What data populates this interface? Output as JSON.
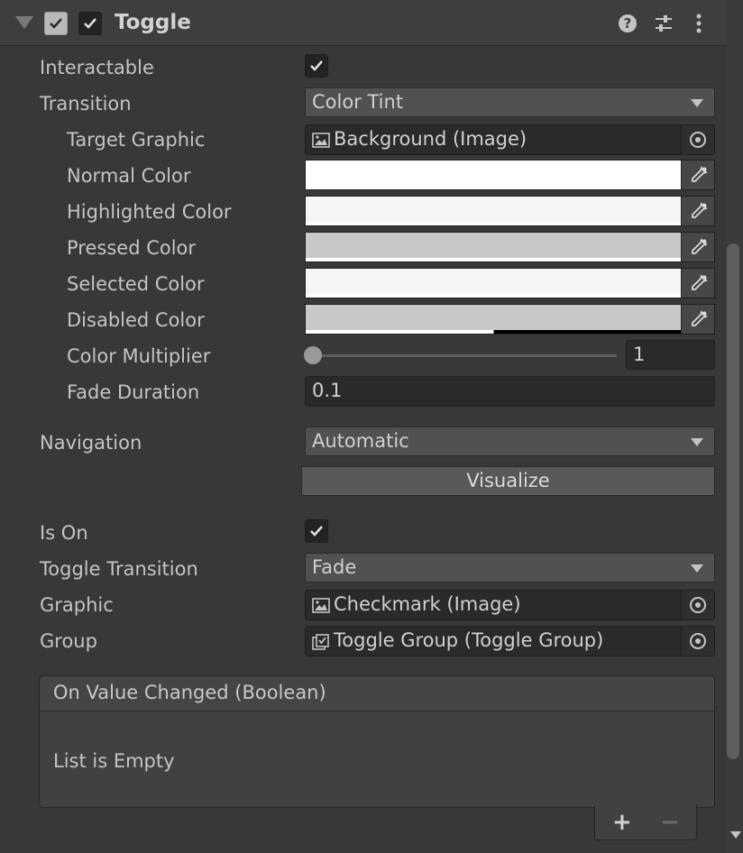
{
  "component": {
    "title": "Toggle"
  },
  "fields": {
    "interactable_label": "Interactable",
    "transition_label": "Transition",
    "transition_value": "Color Tint",
    "target_graphic_label": "Target Graphic",
    "target_graphic_value": "Background (Image)",
    "normal_color_label": "Normal Color",
    "highlighted_color_label": "Highlighted Color",
    "pressed_color_label": "Pressed Color",
    "selected_color_label": "Selected Color",
    "disabled_color_label": "Disabled Color",
    "color_multiplier_label": "Color Multiplier",
    "color_multiplier_value": "1",
    "fade_duration_label": "Fade Duration",
    "fade_duration_value": "0.1",
    "navigation_label": "Navigation",
    "navigation_value": "Automatic",
    "visualize_label": "Visualize",
    "is_on_label": "Is On",
    "toggle_transition_label": "Toggle Transition",
    "toggle_transition_value": "Fade",
    "graphic_label": "Graphic",
    "graphic_value": "Checkmark (Image)",
    "group_label": "Group",
    "group_value": "Toggle Group (Toggle Group)"
  },
  "colors": {
    "normal": "#ffffff",
    "highlighted": "#f5f5f5",
    "pressed": "#c8c8c8",
    "selected": "#f5f5f5",
    "disabled": "#c8c8c8"
  },
  "event": {
    "header": "On Value Changed (Boolean)",
    "empty_text": "List is Empty",
    "add_symbol": "+",
    "remove_symbol": "−"
  },
  "icons": [
    "foldout-arrow-icon",
    "checkbox-icon",
    "help-icon",
    "presets-icon",
    "kebab-menu-icon",
    "image-icon",
    "object-picker-icon",
    "eyedropper-icon",
    "toggle-group-icon"
  ]
}
